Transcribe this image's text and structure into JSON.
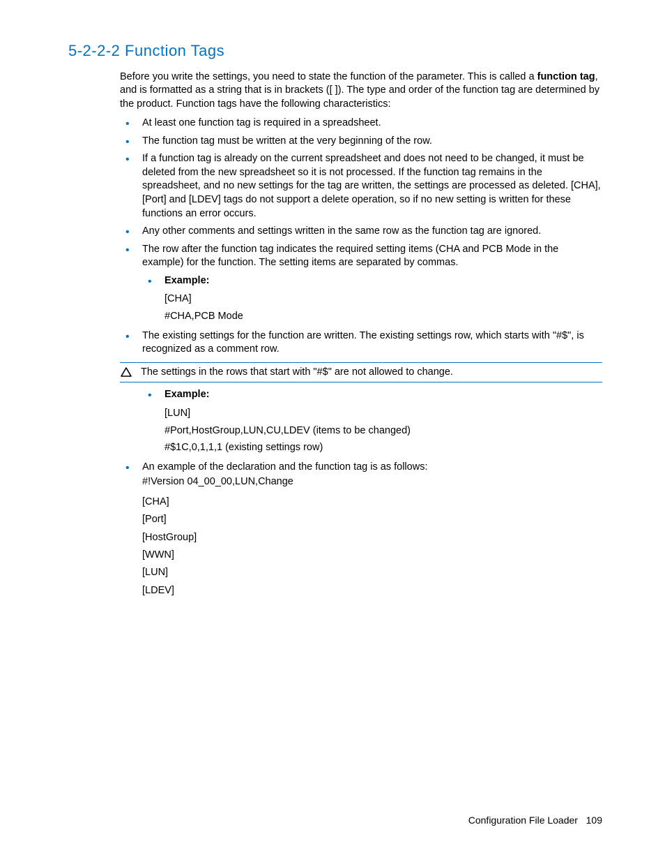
{
  "heading": "5-2-2-2 Function Tags",
  "intro_pre": "Before you write the settings, you need to state the function of the parameter. This is called a ",
  "intro_bold": "function tag",
  "intro_post": ", and is formatted as a string that is in brackets ([ ]). The type and order of the function tag are determined by the product. Function tags have the following characteristics:",
  "bullets": {
    "b1": "At least one function tag is required in a spreadsheet.",
    "b2": "The function tag must be written at the very beginning of the row.",
    "b3": "If a function tag is already on the current spreadsheet and does not need to be changed, it must be deleted from the new spreadsheet so it is not processed. If the function tag remains in the spreadsheet, and no new settings for the tag are written, the settings are processed as deleted. [CHA], [Port] and [LDEV] tags do not support a delete operation, so if no new setting is written for these functions an error occurs.",
    "b4": "Any other comments and settings written in the same row as the function tag are ignored.",
    "b5": "The row after the function tag indicates the required setting items (CHA and PCB Mode in the example) for the function. The setting items are separated by commas.",
    "b6": "The existing settings for the function are written. The existing settings row, which starts with \"#$\", is recognized as a comment row.",
    "b7": "An example of the declaration and the function tag is as follows:"
  },
  "example_label": "Example:",
  "example1": {
    "l1": "[CHA]",
    "l2": "#CHA,PCB Mode"
  },
  "callout_text": "The settings in the rows that start with \"#$\" are not allowed to change.",
  "example2": {
    "l1": "[LUN]",
    "l2": "#Port,HostGroup,LUN,CU,LDEV (items to be changed)",
    "l3": "#$1C,0,1,1,1 (existing settings row)"
  },
  "decl": {
    "l0": "#!Version 04_00_00,LUN,Change",
    "l1": "[CHA]",
    "l2": "[Port]",
    "l3": "[HostGroup]",
    "l4": "[WWN]",
    "l5": "[LUN]",
    "l6": "[LDEV]"
  },
  "footer_label": "Configuration File Loader",
  "footer_page": "109"
}
